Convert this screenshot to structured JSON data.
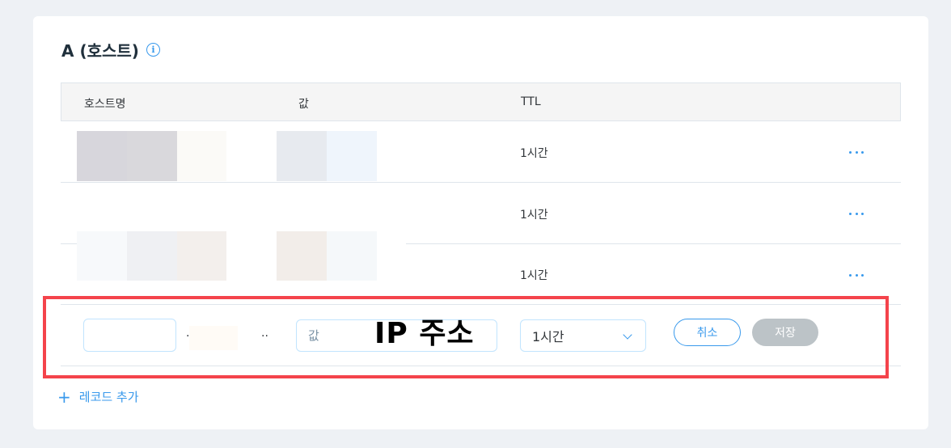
{
  "section": {
    "title": "A (호스트)",
    "info_icon": "i"
  },
  "table": {
    "headers": [
      "호스트명",
      "값",
      "TTL"
    ],
    "rows": [
      {
        "ttl": "1시간"
      },
      {
        "ttl": "1시간"
      },
      {
        "ttl": "1시간"
      }
    ]
  },
  "edit_row": {
    "host_sep": ".",
    "host_ellipsis": "..",
    "value_placeholder": "값",
    "value_annotation": "IP 주소",
    "ttl_selected": "1시간",
    "cancel_label": "취소",
    "save_label": "저장"
  },
  "add_record": {
    "plus": "+",
    "label": "레코드 추가"
  },
  "colors": {
    "accent": "#3899ec",
    "highlight": "#f4434b",
    "disabled": "#bcc3c7"
  }
}
